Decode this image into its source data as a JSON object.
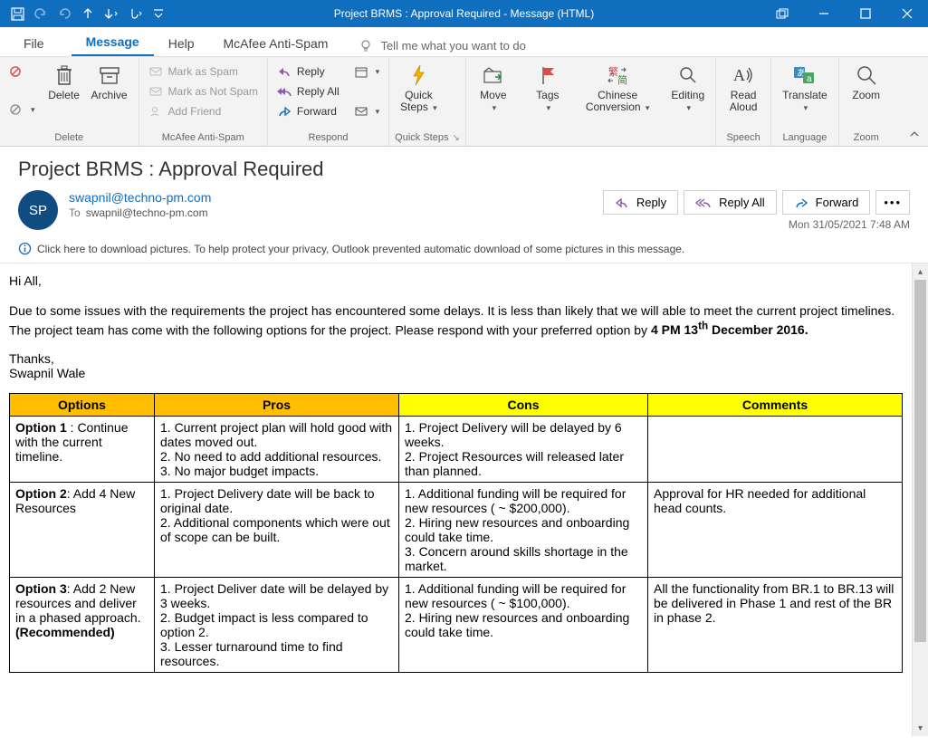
{
  "window": {
    "title": "Project BRMS : Approval Required  -  Message (HTML)"
  },
  "tabs": {
    "file": "File",
    "message": "Message",
    "help": "Help",
    "mcafee": "McAfee Anti-Spam",
    "tellme": "Tell me what you want to do"
  },
  "ribbon": {
    "delete_group": {
      "label": "Delete",
      "delete": "Delete",
      "archive": "Archive"
    },
    "spam_group": {
      "label": "McAfee Anti-Spam",
      "mark_spam": "Mark as Spam",
      "mark_not_spam": "Mark as Not Spam",
      "add_friend": "Add Friend"
    },
    "respond_group": {
      "label": "Respond",
      "reply": "Reply",
      "reply_all": "Reply All",
      "forward": "Forward"
    },
    "quick_steps": {
      "label": "Quick Steps",
      "btn_line1": "Quick",
      "btn_line2": "Steps"
    },
    "move": {
      "label": "Move",
      "btn": "Move"
    },
    "tags": {
      "label": "Tags",
      "btn": "Tags"
    },
    "chinese": {
      "btn_line1": "Chinese",
      "btn_line2": "Conversion"
    },
    "editing": {
      "label": "Editing",
      "btn": "Editing"
    },
    "speech": {
      "label": "Speech",
      "btn_line1": "Read",
      "btn_line2": "Aloud"
    },
    "language": {
      "label": "Language",
      "btn": "Translate"
    },
    "zoom": {
      "label": "Zoom",
      "btn": "Zoom"
    }
  },
  "email": {
    "subject": "Project BRMS : Approval Required",
    "avatar": "SP",
    "from": "swapnil@techno-pm.com",
    "to_label": "To",
    "to": "swapnil@techno-pm.com",
    "timestamp": "Mon 31/05/2021 7:48 AM",
    "actions": {
      "reply": "Reply",
      "reply_all": "Reply All",
      "forward": "Forward"
    },
    "infobar": "Click here to download pictures. To help protect your privacy, Outlook prevented automatic download of some pictures in this message."
  },
  "body": {
    "greeting": "Hi All,",
    "para_a": "Due to some issues with the requirements the project has encountered some delays. It is less than likely that we will able to meet the current project timelines. The project team has come with the following options for the project.  Please respond with your preferred option by ",
    "deadline_bold1": "4 PM 13",
    "deadline_sup": "th",
    "deadline_bold2": " December 2016.",
    "thanks": "Thanks,",
    "sig": "Swapnil Wale"
  },
  "table": {
    "headers": {
      "options": "Options",
      "pros": "Pros",
      "cons": "Cons",
      "comments": "Comments"
    },
    "rows": [
      {
        "opt_bold": "Option 1",
        "opt_rest": " : Continue with the current timeline.",
        "pros": "1. Current project plan will hold good with dates moved out.\n2. No need to add additional resources.\n3. No major budget impacts.",
        "cons": "1. Project Delivery will be delayed by 6 weeks.\n2. Project Resources will released later than planned.",
        "comments": ""
      },
      {
        "opt_bold": "Option 2",
        "opt_rest": ": Add 4 New Resources",
        "pros": "1. Project Delivery date will be back to original date.\n2. Additional components which were out of scope can be built.",
        "cons": "1. Additional funding will be required for new resources ( ~ $200,000).\n2. Hiring new resources and onboarding could take time.\n3. Concern around skills shortage in the market.",
        "comments": "Approval for HR needed for additional head counts."
      },
      {
        "opt_bold": "Option 3",
        "opt_rest": ": Add 2 New resources and deliver in a phased approach. ",
        "opt_rec": "(Recommended)",
        "pros": "1. Project Deliver date will be delayed by 3 weeks.\n2. Budget impact is less compared to option 2.\n3. Lesser turnaround time to find resources.",
        "cons": "1. Additional funding will be required for new resources ( ~ $100,000).\n2. Hiring new resources and onboarding could take time.",
        "comments": "All the functionality from BR.1 to BR.13 will be delivered in Phase 1 and rest of the BR in phase 2."
      }
    ]
  }
}
